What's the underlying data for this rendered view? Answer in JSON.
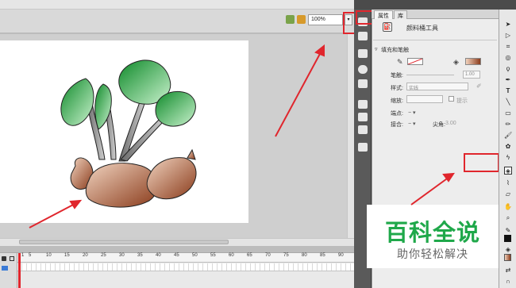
{
  "toolbar": {
    "zoom_value": "100%",
    "zoom_dropdown_icon": "chevron-down-icon"
  },
  "timeline": {
    "frame_numbers": [
      "1",
      "5",
      "10",
      "15",
      "20",
      "25",
      "30",
      "35",
      "40",
      "45",
      "50",
      "55",
      "60",
      "65",
      "70",
      "75",
      "80",
      "85",
      "90"
    ]
  },
  "properties": {
    "tab_properties": "属性",
    "tab_library": "库",
    "tool_name": "颜料桶工具",
    "section_fill_stroke": "填充和笔触",
    "stroke_label": "笔触:",
    "stroke_value": "1.00",
    "style_label": "样式:",
    "style_value": "实线",
    "scale_label": "缩放:",
    "hint_label": "提示",
    "cap_label": "端点:",
    "join_label": "接合:",
    "miter_label": "尖角:",
    "miter_value": "3.00"
  },
  "colors": {
    "stroke_color": "#ffffff",
    "fill_gradient_start": "#f2d2bd",
    "fill_gradient_end": "#8b3c1c",
    "highlight": "#e0262d"
  },
  "watermark": {
    "title": "百科全说",
    "subtitle": "助你轻松解决"
  }
}
